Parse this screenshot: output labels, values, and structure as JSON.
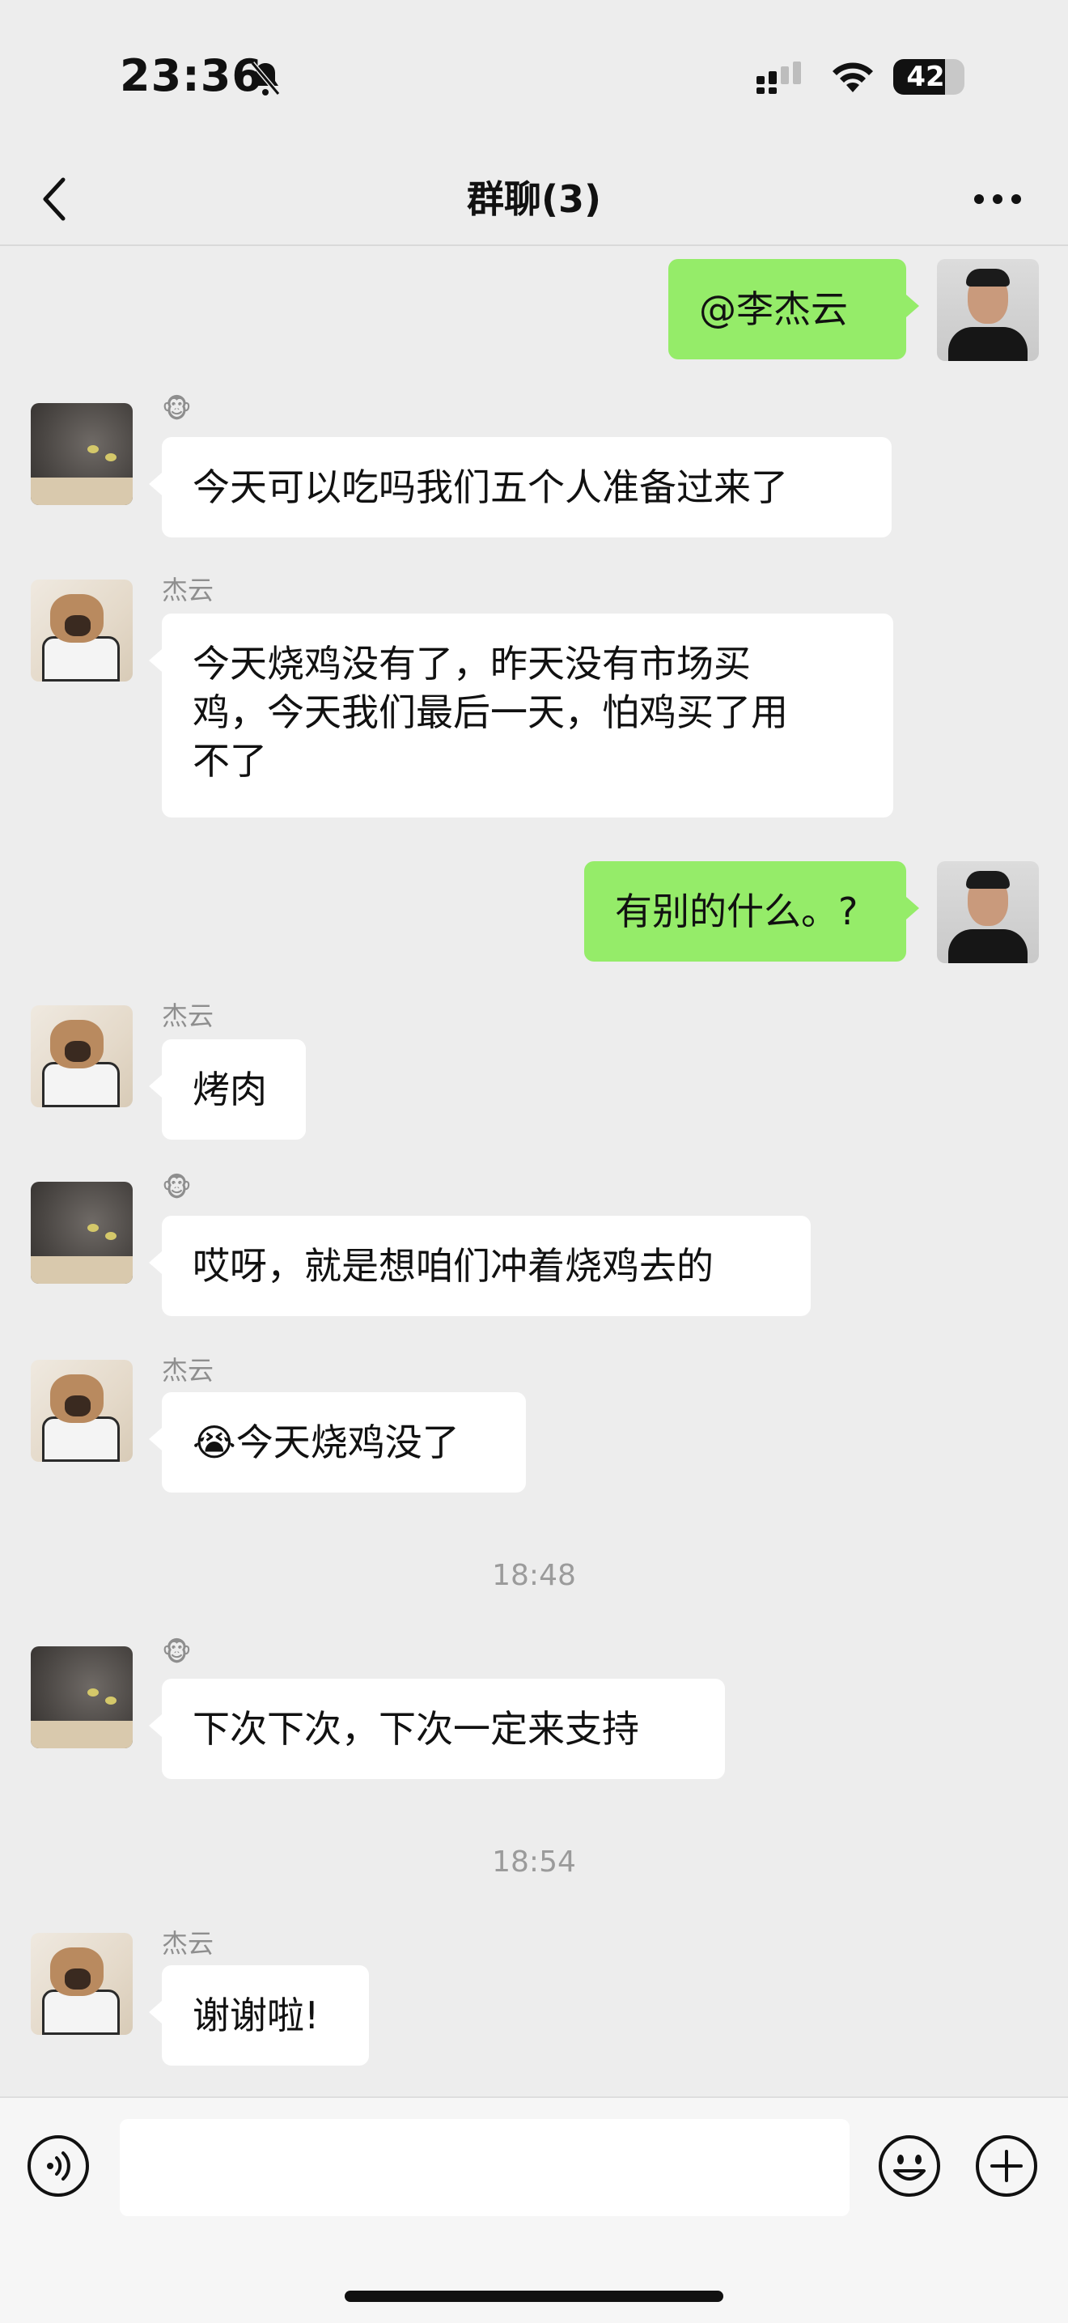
{
  "status_bar": {
    "time": "23:36",
    "battery": "42"
  },
  "header": {
    "title": "群聊(3)"
  },
  "messages": [
    {
      "side": "right",
      "text": "@李杰云"
    },
    {
      "side": "left",
      "sender": "🐵",
      "text": "今天可以吃吗我们五个人准备过来了"
    },
    {
      "side": "left",
      "sender": "杰云",
      "text": "今天烧鸡没有了，昨天没有市场买\n鸡，今天我们最后一天，怕鸡买了用\n不了"
    },
    {
      "side": "right",
      "text": "有别的什么。?"
    },
    {
      "side": "left",
      "sender": "杰云",
      "text": "烤肉"
    },
    {
      "side": "left",
      "sender": "🐵",
      "text": "哎呀，就是想咱们冲着烧鸡去的"
    },
    {
      "side": "left",
      "sender": "杰云",
      "text": "😭今天烧鸡没了"
    },
    {
      "side": "left",
      "sender": "🐵",
      "text": "下次下次，下次一定来支持"
    },
    {
      "side": "left",
      "sender": "杰云",
      "text": "谢谢啦!"
    }
  ],
  "timestamps": [
    "18:48",
    "18:54"
  ],
  "icons": {
    "back": "chevron-left-icon",
    "more": "more-dots-icon",
    "voice": "voice-icon",
    "emoji": "emoji-icon",
    "plus": "plus-icon",
    "bell": "bell-slash-icon",
    "signal": "signal-icon",
    "wifi": "wifi-icon"
  },
  "colors": {
    "background": "#ededed",
    "bubble_self": "#95ec69",
    "bubble_other": "#ffffff"
  }
}
